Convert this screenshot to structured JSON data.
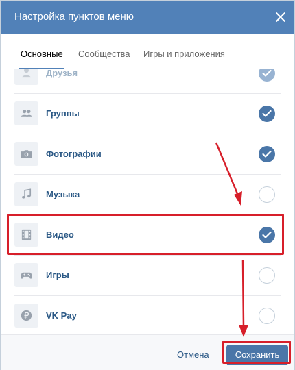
{
  "dialog": {
    "title": "Настройка пунктов меню",
    "close_icon": "close-icon"
  },
  "tabs": [
    {
      "label": "Основные",
      "active": true
    },
    {
      "label": "Сообщества",
      "active": false
    },
    {
      "label": "Игры и приложения",
      "active": false
    }
  ],
  "items": [
    {
      "label": "Друзья",
      "icon": "person-icon",
      "checked": true
    },
    {
      "label": "Группы",
      "icon": "people-icon",
      "checked": true
    },
    {
      "label": "Фотографии",
      "icon": "camera-icon",
      "checked": true
    },
    {
      "label": "Музыка",
      "icon": "music-note-icon",
      "checked": false
    },
    {
      "label": "Видео",
      "icon": "film-icon",
      "checked": true
    },
    {
      "label": "Игры",
      "icon": "gamepad-icon",
      "checked": false
    },
    {
      "label": "VK Pay",
      "icon": "ruble-coin-icon",
      "checked": false
    }
  ],
  "footer": {
    "cancel_label": "Отмена",
    "save_label": "Сохранить"
  },
  "colors": {
    "header": "#5181b8",
    "accent": "#4a76a8",
    "annotation": "#d71f2a"
  }
}
